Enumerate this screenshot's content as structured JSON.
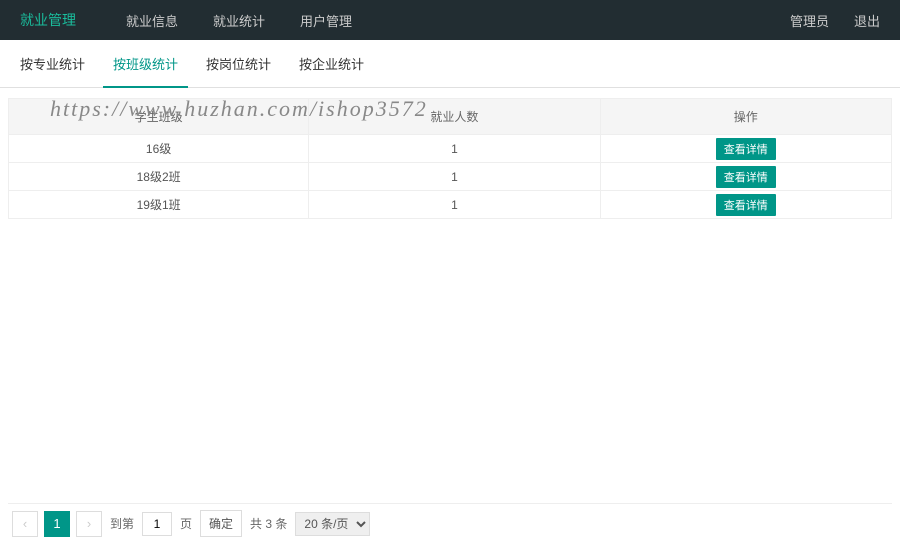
{
  "navbar": {
    "brand": "就业管理",
    "links": [
      "就业信息",
      "就业统计",
      "用户管理"
    ],
    "right": [
      "管理员",
      "退出"
    ]
  },
  "tabs": {
    "items": [
      "按专业统计",
      "按班级统计",
      "按岗位统计",
      "按企业统计"
    ],
    "activeIndex": 1
  },
  "watermark": "https://www.huzhan.com/ishop3572",
  "table": {
    "headers": {
      "class": "学生班级",
      "count": "就业人数",
      "action": "操作"
    },
    "rows": [
      {
        "class": "16级",
        "count": "1"
      },
      {
        "class": "18级2班",
        "count": "1"
      },
      {
        "class": "19级1班",
        "count": "1"
      }
    ],
    "detailBtn": "查看详情"
  },
  "pager": {
    "prev": "‹",
    "next": "›",
    "current": "1",
    "gotoLabel": "到第",
    "pageInput": "1",
    "pageSuffix": "页",
    "confirm": "确定",
    "totalText": "共 3 条",
    "pageSize": "20 条/页"
  }
}
